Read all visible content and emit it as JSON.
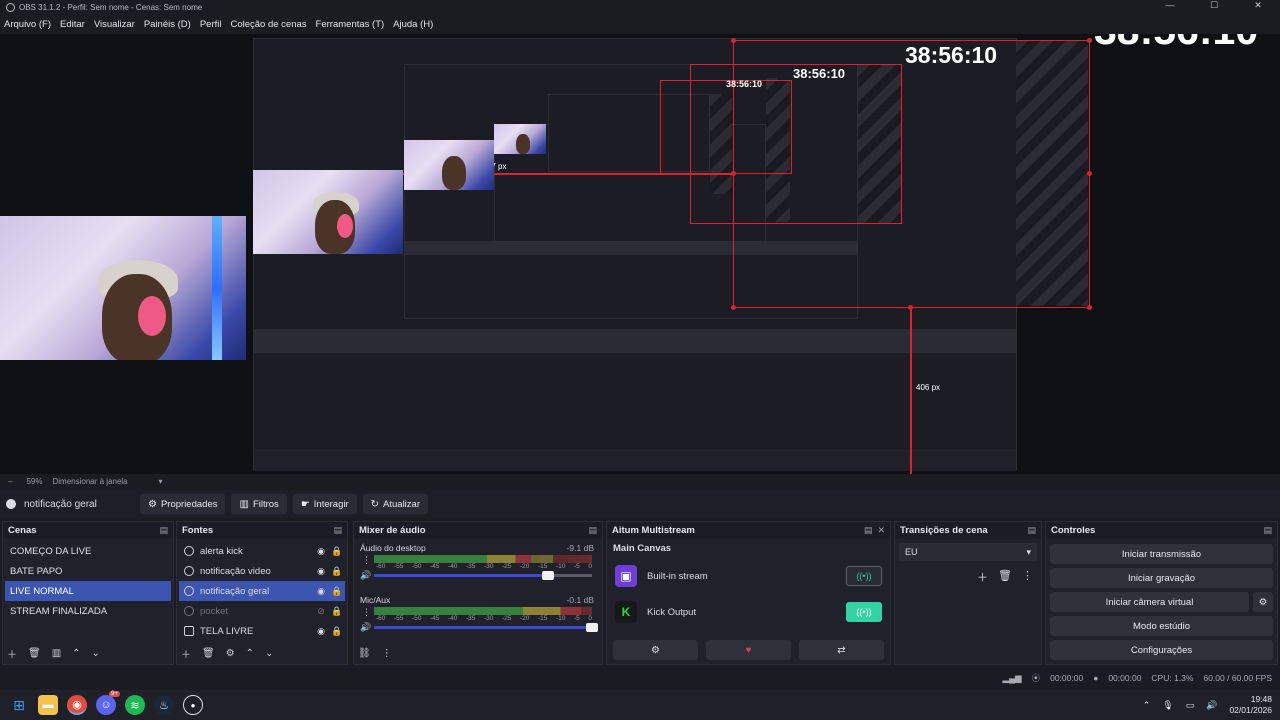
{
  "window": {
    "title": "OBS 31.1.2 - Perfil: Sem nome - Cenas: Sem nome"
  },
  "menu": [
    "Arquivo (F)",
    "Editar",
    "Visualizar",
    "Painéis (D)",
    "Perfil",
    "Coleção de cenas",
    "Ferramentas (T)",
    "Ajuda (H)"
  ],
  "preview": {
    "timer": "38:56:10",
    "measure_width": "1207 px",
    "measure_height": "406 px"
  },
  "zoom": {
    "level": "59%",
    "mode": "Dimensionar à janela"
  },
  "source_toolbar": {
    "current_source": "notificação geral",
    "properties": "Propriedades",
    "filters": "Filtros",
    "interact": "Interagir",
    "refresh": "Atualizar"
  },
  "scenes": {
    "title": "Cenas",
    "items": [
      "COMEÇO DA LIVE",
      "BATE PAPO",
      "LIVE NORMAL",
      "STREAM FINALIZADA"
    ],
    "selected": 2
  },
  "sources": {
    "title": "Fontes",
    "items": [
      {
        "name": "alerta kick",
        "icon": "browser-icon"
      },
      {
        "name": "notificação video",
        "icon": "browser-icon"
      },
      {
        "name": "notificação geral",
        "icon": "browser-icon"
      },
      {
        "name": "pocket",
        "icon": "browser-icon"
      },
      {
        "name": "TELA LIVRE",
        "icon": "display-capture-icon"
      }
    ],
    "selected": 2,
    "hidden": 3
  },
  "mixer": {
    "title": "Mixer de áudio",
    "channels": [
      {
        "name": "Áudio do desktop",
        "db": "-9.1 dB",
        "level": 0.72,
        "volume": 0.8
      },
      {
        "name": "Mic/Aux",
        "db": "-0.1 dB",
        "level": 0.95,
        "volume": 1.0
      }
    ],
    "scale": [
      "-60",
      "-55",
      "-50",
      "-45",
      "-40",
      "-35",
      "-30",
      "-25",
      "-20",
      "-15",
      "-10",
      "-5",
      "0"
    ]
  },
  "multistream": {
    "title": "Aitum Multistream",
    "canvas": "Main Canvas",
    "outputs": [
      {
        "name": "Built-in stream",
        "logo": "twitch-icon",
        "color": "#6e3fd8",
        "active": false
      },
      {
        "name": "Kick Output",
        "logo": "kick-icon",
        "color": "#1fdc3b",
        "active": true
      }
    ]
  },
  "transitions": {
    "title": "Transições de cena",
    "selected": "EU"
  },
  "controls": {
    "title": "Controles",
    "buttons": [
      "Iniciar transmissão",
      "Iniciar gravação",
      "Iniciar câmera virtual",
      "Modo estúdio",
      "Configurações"
    ]
  },
  "status": {
    "stream_time": "00:00:00",
    "rec_time": "00:00:00",
    "cpu": "CPU: 1.3%",
    "fps": "60.00 / 60.00 FPS"
  },
  "taskbar": {
    "time": "19:48",
    "date": "02/01/2026",
    "discord_badge": "9+"
  },
  "colors": {
    "selection": "#3c56b0",
    "accent_red": "#e0202a",
    "twitch": "#6e3fd8",
    "kick": "#1fdc3b"
  }
}
